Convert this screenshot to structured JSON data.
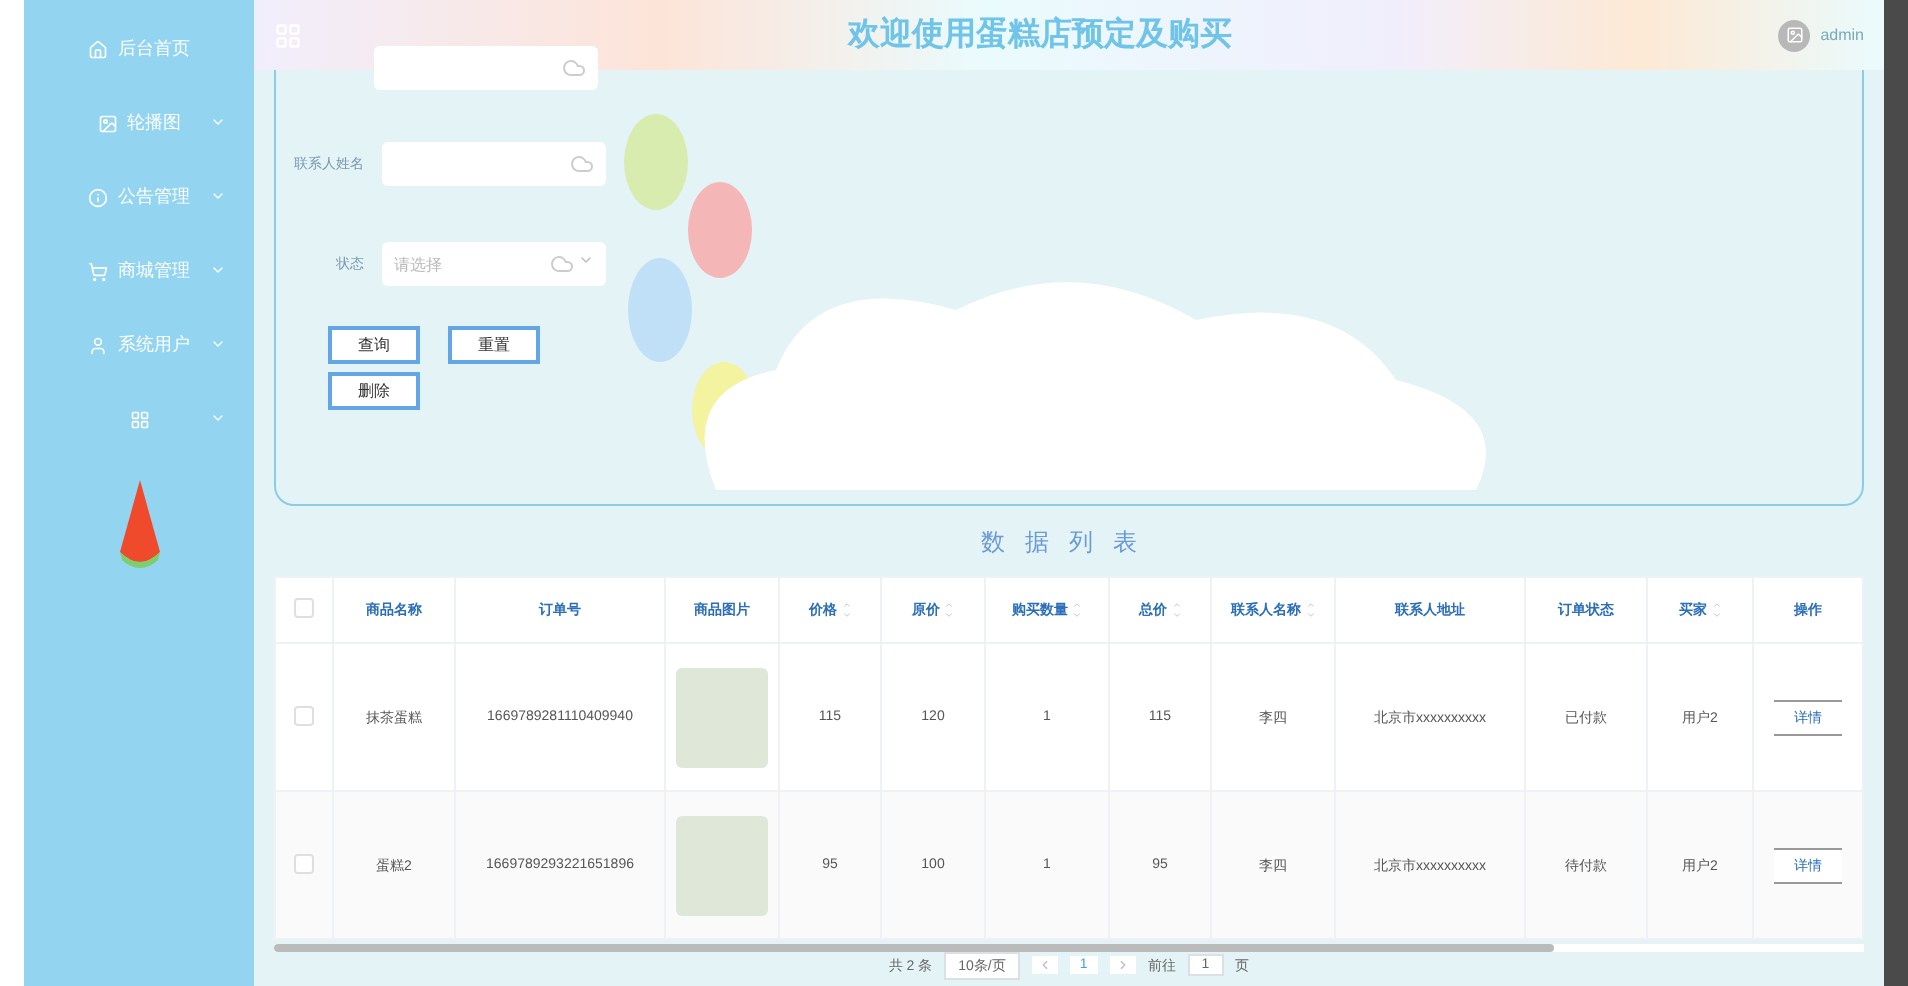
{
  "sidebar": {
    "items": [
      {
        "kind": "home",
        "label": "后台首页"
      },
      {
        "kind": "image",
        "label": "轮播图",
        "expanded": false
      },
      {
        "kind": "notice",
        "label": "公告管理",
        "expanded": false
      },
      {
        "kind": "cart",
        "label": "商城管理",
        "expanded": false
      },
      {
        "kind": "user",
        "label": "系统用户",
        "expanded": false
      },
      {
        "kind": "grid",
        "expanded": false
      }
    ]
  },
  "header": {
    "title": "欢迎使用蛋糕店预定及购买",
    "user": "admin"
  },
  "search": {
    "fields": [
      {
        "kind": "input"
      },
      {
        "kind": "input",
        "label": "联系人姓名"
      },
      {
        "kind": "select",
        "label": "状态",
        "placeholder": "请选择"
      }
    ],
    "buttons": [
      "查询",
      "重置",
      "删除"
    ]
  },
  "table": {
    "title": "数据列表",
    "select_all_checked": false,
    "columns": [
      {
        "kind": "text",
        "label": "商品名称",
        "sortable": false
      },
      {
        "kind": "text",
        "label": "订单号",
        "sortable": false
      },
      {
        "kind": "image",
        "label": "商品图片",
        "sortable": false
      },
      {
        "kind": "text",
        "label": "价格",
        "sortable": true
      },
      {
        "kind": "text",
        "label": "原价",
        "sortable": true
      },
      {
        "kind": "text",
        "label": "购买数量",
        "sortable": true
      },
      {
        "kind": "text",
        "label": "总价",
        "sortable": true
      },
      {
        "kind": "text",
        "label": "联系人名称",
        "sortable": true
      },
      {
        "kind": "text",
        "label": "联系人地址",
        "sortable": false
      },
      {
        "kind": "text",
        "label": "订单状态",
        "sortable": false
      },
      {
        "kind": "text",
        "label": "买家",
        "sortable": true
      },
      {
        "kind": "action",
        "label": "操作",
        "sortable": false
      }
    ],
    "rows": [
      {
        "selected": false,
        "cells": [
          "抹茶蛋糕",
          "1669789281110409940",
          "",
          "115",
          "120",
          "1",
          "115",
          "李四",
          "北京市xxxxxxxxxx",
          "已付款",
          "用户2",
          "详情"
        ]
      },
      {
        "selected": false,
        "cells": [
          "蛋糕2",
          "1669789293221651896",
          "",
          "95",
          "100",
          "1",
          "95",
          "李四",
          "北京市xxxxxxxxxx",
          "待付款",
          "用户2",
          "详情"
        ]
      }
    ]
  },
  "pagination": {
    "total": "共 2 条",
    "page_size": "10条/页",
    "pages": [
      {
        "label": "1",
        "selected": true
      }
    ],
    "goto_label": "前往",
    "goto_value": "1",
    "goto_suffix": "页"
  }
}
